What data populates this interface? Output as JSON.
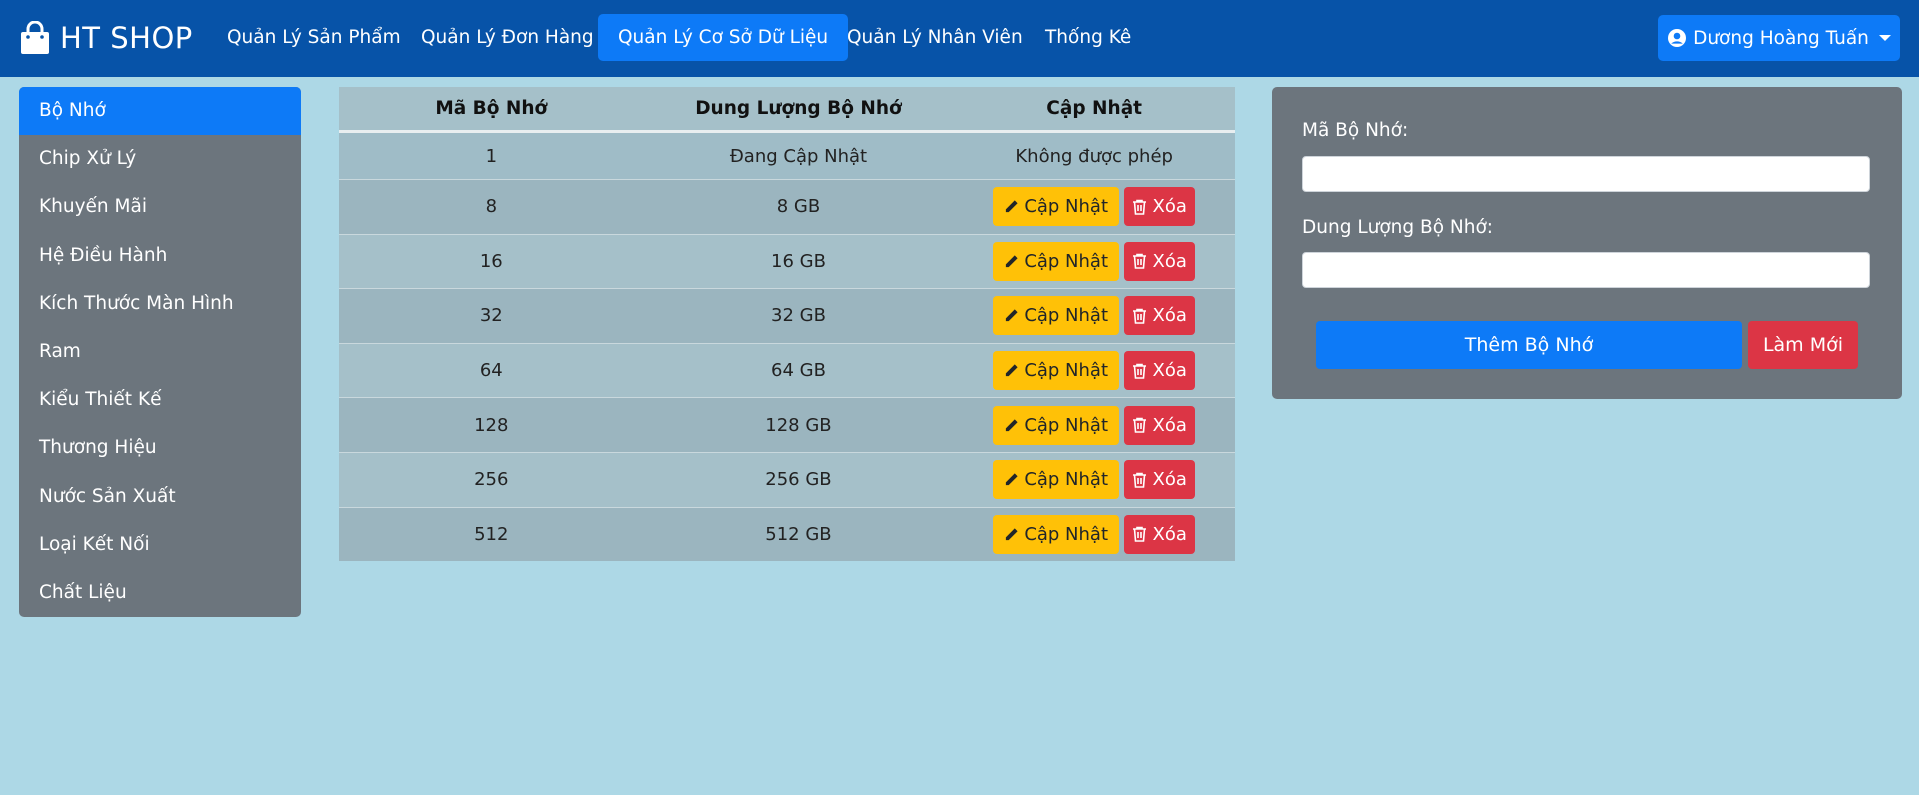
{
  "brand": {
    "name": "HT SHOP",
    "icon": "shopping-bag-icon"
  },
  "nav": {
    "items": [
      {
        "label": "Quản Lý Sản Phẩm",
        "active": false
      },
      {
        "label": "Quản Lý Đơn Hàng",
        "active": false
      },
      {
        "label": "Quản Lý Cơ Sở Dữ Liệu",
        "active": true
      },
      {
        "label": "Quản Lý Nhân Viên",
        "active": false
      },
      {
        "label": "Thống Kê",
        "active": false
      }
    ],
    "user": {
      "name": "Dương Hoàng Tuấn",
      "icon": "user-circle-icon"
    }
  },
  "sidebar": {
    "items": [
      {
        "label": "Bộ Nhớ",
        "active": true
      },
      {
        "label": "Chip Xử Lý"
      },
      {
        "label": "Khuyến Mãi"
      },
      {
        "label": "Hệ Điều Hành"
      },
      {
        "label": "Kích Thước Màn Hình"
      },
      {
        "label": "Ram"
      },
      {
        "label": "Kiểu Thiết Kế"
      },
      {
        "label": "Thương Hiệu"
      },
      {
        "label": "Nước Sản Xuất"
      },
      {
        "label": "Loại Kết Nối"
      },
      {
        "label": "Chất Liệu"
      }
    ]
  },
  "table": {
    "headers": [
      "Mã Bộ Nhớ",
      "Dung Lượng Bộ Nhớ",
      "Cập Nhật"
    ],
    "first_row": {
      "id": "1",
      "capacity": "Đang Cập Nhật",
      "action_text": "Không được phép"
    },
    "rows": [
      {
        "id": "8",
        "capacity": "8 GB"
      },
      {
        "id": "16",
        "capacity": "16 GB"
      },
      {
        "id": "32",
        "capacity": "32 GB"
      },
      {
        "id": "64",
        "capacity": "64 GB"
      },
      {
        "id": "128",
        "capacity": "128 GB"
      },
      {
        "id": "256",
        "capacity": "256 GB"
      },
      {
        "id": "512",
        "capacity": "512 GB"
      }
    ],
    "update_label": "Cập Nhật",
    "delete_label": "Xóa",
    "update_icon": "pencil-icon",
    "delete_icon": "trash-icon"
  },
  "form": {
    "id_label": "Mã Bộ Nhớ:",
    "id_value": "",
    "capacity_label": "Dung Lượng Bộ Nhớ:",
    "capacity_value": "",
    "add_label": "Thêm Bộ Nhớ",
    "reset_label": "Làm Mới"
  },
  "colors": {
    "navbar": "#0753a8",
    "primary": "#0d7af7",
    "warning": "#ffc107",
    "danger": "#dc3545",
    "panel": "#6c757d",
    "background": "#add8e6"
  }
}
